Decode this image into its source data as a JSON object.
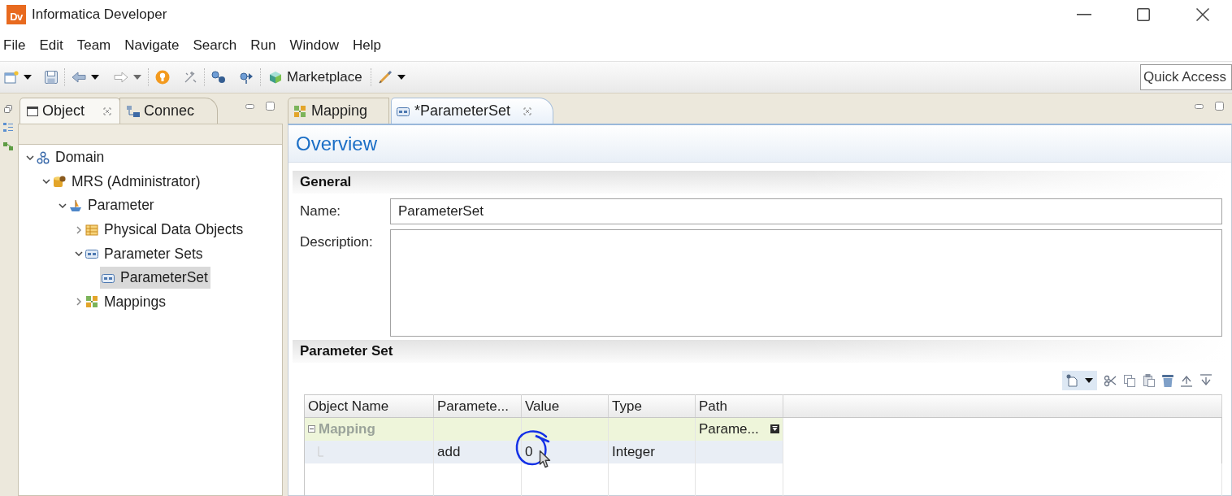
{
  "window": {
    "logo": "Dv",
    "title": "Informatica Developer"
  },
  "menu": [
    "File",
    "Edit",
    "Team",
    "Navigate",
    "Search",
    "Run",
    "Window",
    "Help"
  ],
  "toolbar": {
    "marketplace": "Marketplace",
    "quick_access": {
      "placeholder": "Quick Access"
    }
  },
  "object_panel": {
    "tabs": [
      {
        "label": "Object",
        "selected": true
      },
      {
        "label": "Connec",
        "selected": false
      }
    ],
    "tree": [
      {
        "label": "Domain",
        "kind": "domain",
        "expanded": true,
        "selected": false,
        "children": [
          {
            "label": "MRS (Administrator)",
            "kind": "repository",
            "expanded": true,
            "selected": false,
            "children": [
              {
                "label": "Parameter",
                "kind": "project",
                "expanded": true,
                "selected": false,
                "children": [
                  {
                    "label": "Physical Data Objects",
                    "kind": "data-objects",
                    "expanded": false,
                    "selected": false
                  },
                  {
                    "label": "Parameter Sets",
                    "kind": "parameter-sets",
                    "expanded": true,
                    "selected": false,
                    "children": [
                      {
                        "label": "ParameterSet",
                        "kind": "parameter-set",
                        "selected": true
                      }
                    ]
                  },
                  {
                    "label": "Mappings",
                    "kind": "mappings",
                    "expanded": false,
                    "selected": false
                  }
                ]
              }
            ]
          }
        ]
      }
    ]
  },
  "editor": {
    "tabs": [
      {
        "label": "Mapping",
        "kind": "mapping",
        "selected": false
      },
      {
        "label": "*ParameterSet",
        "kind": "parameter-set",
        "selected": true
      }
    ],
    "title": "Overview",
    "general": {
      "heading": "General",
      "name": {
        "label": "Name:",
        "value": "ParameterSet"
      },
      "description": {
        "label": "Description:"
      }
    },
    "parameter_set": {
      "heading": "Parameter Set",
      "table": {
        "columns": [
          "Object Name",
          "Paramete...",
          "Value",
          "Type",
          "Path"
        ],
        "rows": [
          {
            "kind": "group",
            "expanded": true,
            "selected": false,
            "object_name": "Mapping",
            "path": "Parame..."
          },
          {
            "kind": "parameter",
            "selected": true,
            "parameter": "add",
            "value": "0",
            "type": "Integer"
          }
        ]
      }
    }
  }
}
